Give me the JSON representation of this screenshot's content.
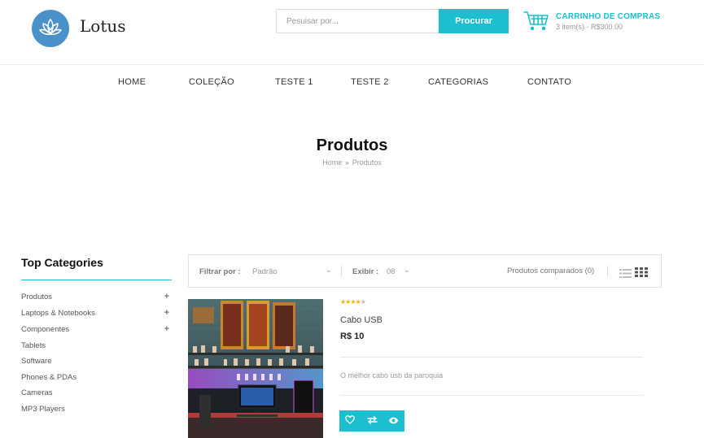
{
  "header": {
    "logo_text": "Lotus",
    "search": {
      "placeholder": "Pesuisar por...",
      "button": "Procurar"
    },
    "cart": {
      "title": "CARRINHO DE COMPRAS",
      "summary": "3 item(s) - R$300.00"
    }
  },
  "nav": {
    "items": [
      "HOME",
      "COLEÇÃO",
      "TESTE 1",
      "TESTE 2",
      "CATEGORIAS",
      "CONTATO"
    ]
  },
  "page": {
    "title": "Produtos",
    "breadcrumb": [
      "Home",
      "Produtos"
    ],
    "breadcrumb_sep": "»"
  },
  "sidebar": {
    "title": "Top Categories",
    "items": [
      {
        "label": "Produtos",
        "expand": "+"
      },
      {
        "label": "Laptops & Notebooks",
        "expand": "+"
      },
      {
        "label": "Componentes",
        "expand": "+"
      },
      {
        "label": "Tablets"
      },
      {
        "label": "Software"
      },
      {
        "label": "Phones & PDAs"
      },
      {
        "label": "Cameras"
      },
      {
        "label": "MP3 Players"
      }
    ]
  },
  "toolbar": {
    "filter_label": "Filtrar por :",
    "filter_value": "Padrão",
    "show_label": "Exibir :",
    "show_value": "08",
    "compare": "Produtos comparados (0)"
  },
  "product": {
    "rating": 4,
    "rating_max": 5,
    "name": "Cabo USB",
    "price": "R$ 10",
    "description": "O melhor cabo usb da paroquia",
    "actions": [
      "heart-icon",
      "compare-icon",
      "eye-icon"
    ]
  },
  "colors": {
    "accent": "#1bbfcf",
    "logo": "#4a90c9",
    "star": "#f5b301"
  }
}
